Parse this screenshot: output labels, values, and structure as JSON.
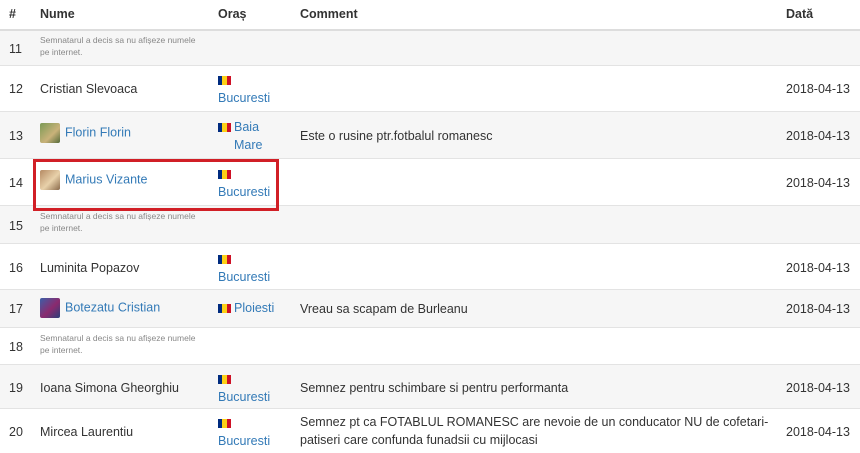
{
  "headers": {
    "num": "#",
    "name": "Nume",
    "city": "Oraș",
    "comment": "Comment",
    "date": "Dată"
  },
  "hidden_note": "Semnatarul a decis sa nu afișeze numele pe internet.",
  "flag_colors": [
    "#002b7f",
    "#fcd116",
    "#ce1126"
  ],
  "rows": [
    {
      "num": "11",
      "name": "",
      "city": "",
      "comment": "",
      "date": ""
    },
    {
      "num": "12",
      "name": "Cristian Slevoaca",
      "city": "Bucuresti",
      "comment": "",
      "date": "2018-04-13"
    },
    {
      "num": "13",
      "name": "Florin Florin",
      "city": "Baia Mare",
      "comment": "Este o rusine ptr.fotbalul romanesc",
      "date": "2018-04-13"
    },
    {
      "num": "14",
      "name": "Marius Vizante",
      "city": "Bucuresti",
      "comment": "",
      "date": "2018-04-13"
    },
    {
      "num": "15",
      "name": "",
      "city": "",
      "comment": "",
      "date": ""
    },
    {
      "num": "16",
      "name": "Luminita Popazov",
      "city": "Bucuresti",
      "comment": "",
      "date": "2018-04-13"
    },
    {
      "num": "17",
      "name": "Botezatu Cristian",
      "city": "Ploiesti",
      "comment": "Vreau sa scapam de Burleanu",
      "date": "2018-04-13"
    },
    {
      "num": "18",
      "name": "",
      "city": "",
      "comment": "",
      "date": ""
    },
    {
      "num": "19",
      "name": "Ioana Simona Gheorghiu",
      "city": "Bucuresti",
      "comment": "Semnez pentru schimbare si pentru performanta",
      "date": "2018-04-13"
    },
    {
      "num": "20",
      "name": "Mircea Laurentiu",
      "city": "Bucuresti",
      "comment": "Semnez pt ca FOTABLUL ROMANESC are nevoie de un conducator NU de cofetari-patiseri care confunda funadsii cu mijlocasi",
      "date": "2018-04-13"
    }
  ]
}
